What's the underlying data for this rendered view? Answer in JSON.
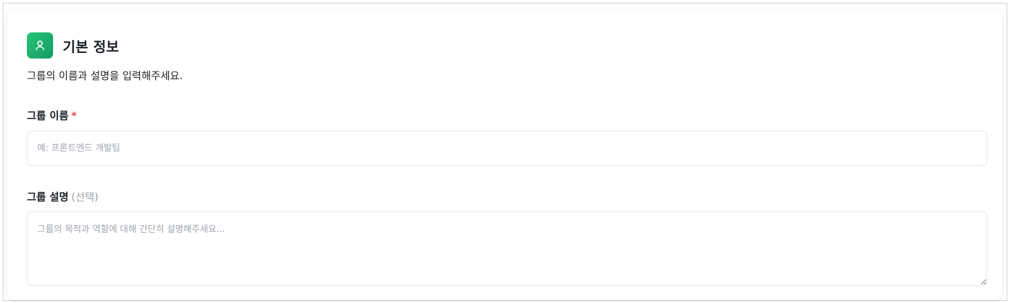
{
  "section": {
    "icon": "user-icon",
    "title": "기본 정보",
    "description": "그룹의 이름과 설명을 입력해주세요."
  },
  "fields": {
    "name": {
      "label": "그룹 이름",
      "required_marker": "*",
      "placeholder": "예: 프론트엔드 개발팀",
      "value": ""
    },
    "description": {
      "label": "그룹 설명",
      "optional_note": "(선택)",
      "placeholder": "그룹의 목적과 역할에 대해 간단히 설명해주세요...",
      "value": ""
    }
  },
  "colors": {
    "accent": "#1fb36e",
    "required": "#e5484d",
    "muted": "#9aa0a6"
  }
}
